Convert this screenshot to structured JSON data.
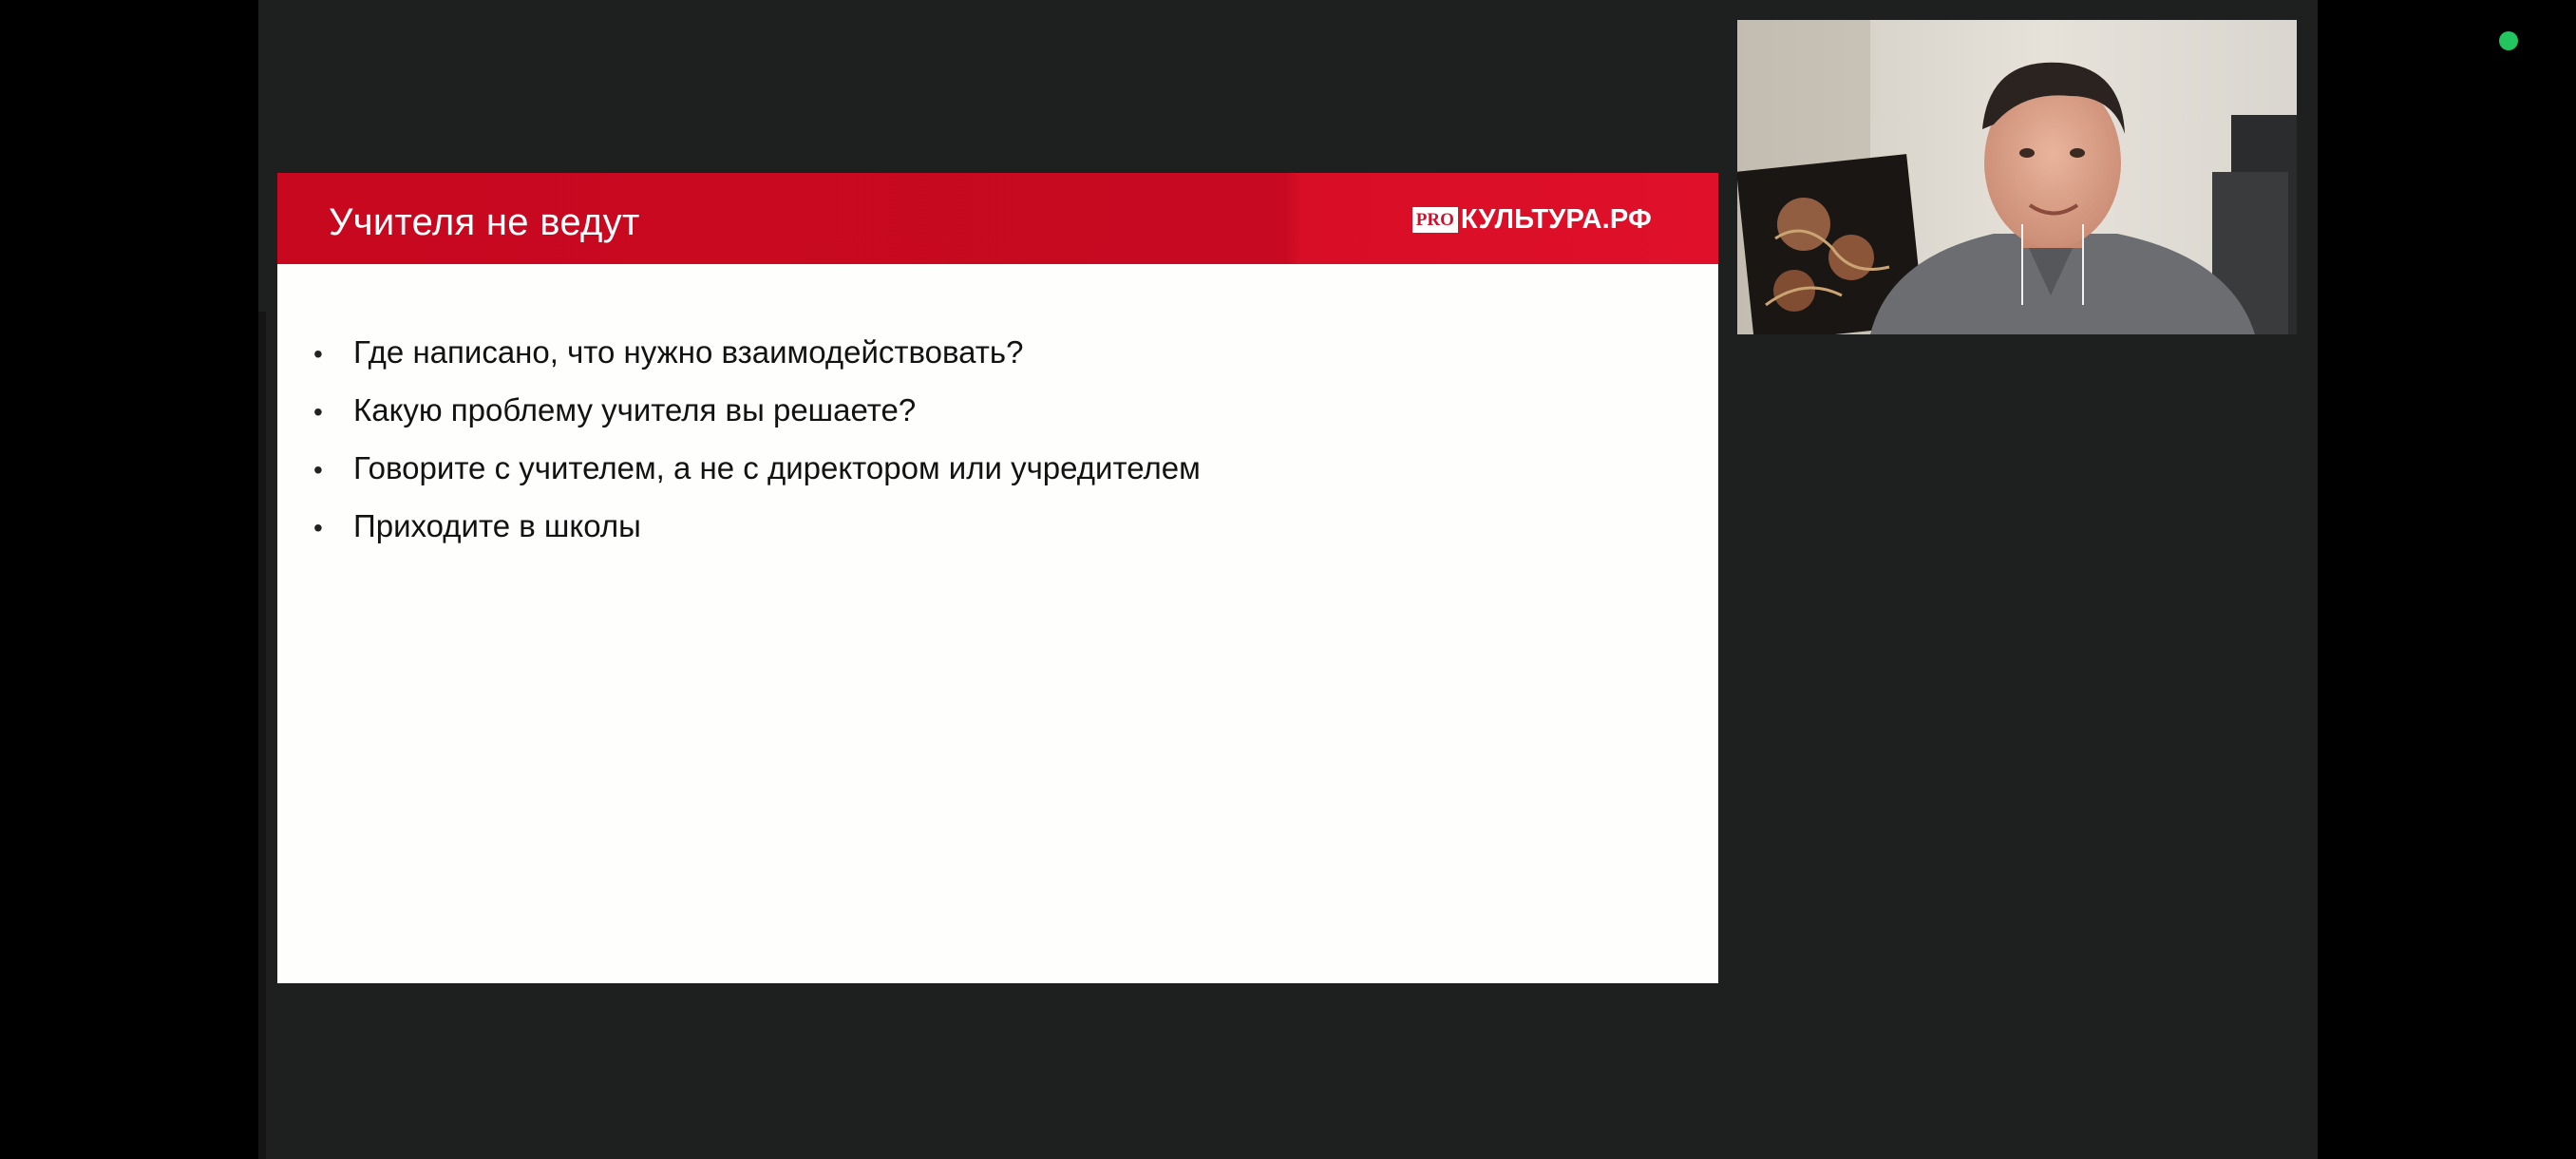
{
  "slide": {
    "title": "Учителя не ведут",
    "brand": {
      "prefix": "PRO",
      "name": "КУЛЬТУРА.РФ"
    },
    "bullets": [
      "Где написано, что нужно взаимодействовать?",
      "Какую проблему учителя вы решаете?",
      "Говорите с учителем, а не с директором или учредителем",
      "Приходите в школы"
    ]
  },
  "colors": {
    "header_red": "#c8081f",
    "slide_bg": "#fefefc",
    "meeting_bg": "#1e1f1f",
    "status_green": "#22c55e"
  },
  "icons": {
    "status": "status-dot-icon",
    "bullet": "bullet-icon"
  }
}
